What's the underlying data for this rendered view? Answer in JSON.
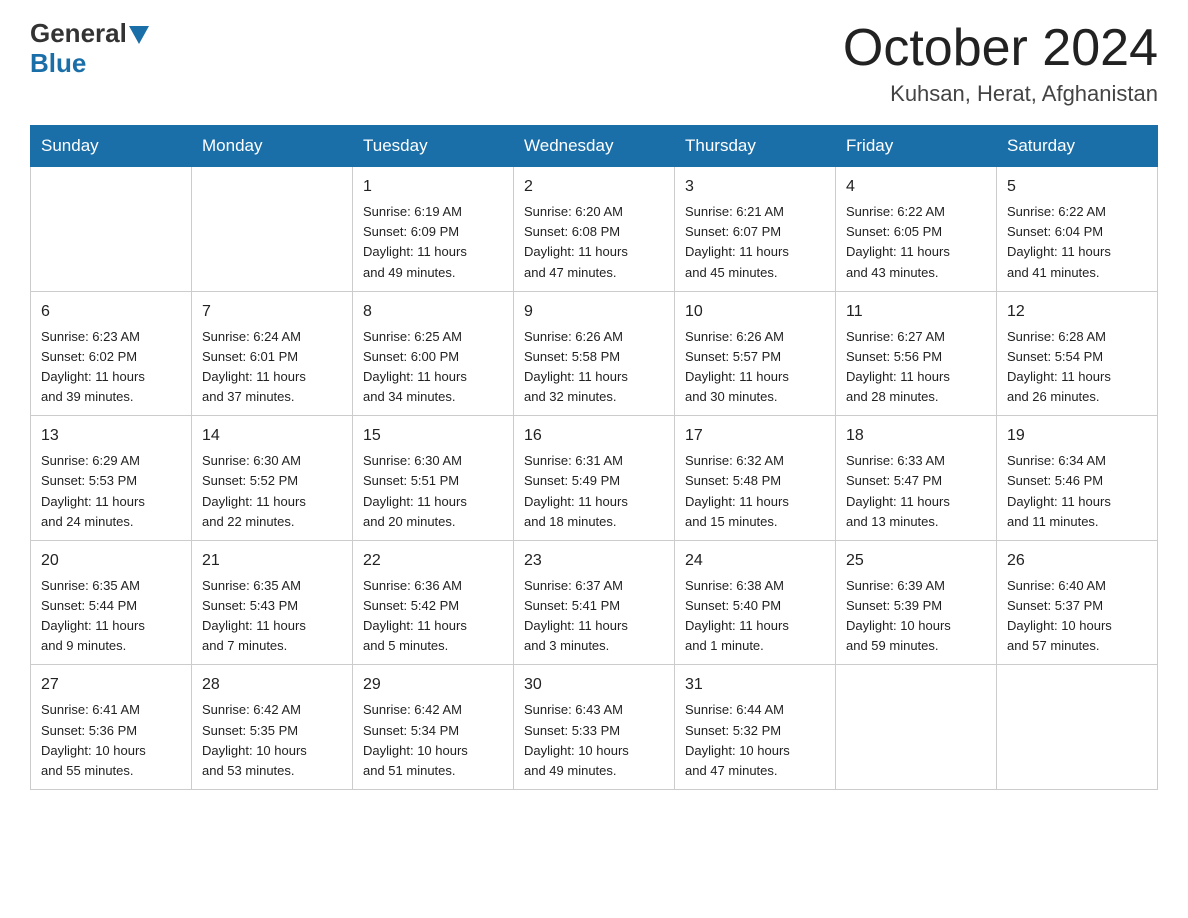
{
  "logo": {
    "general": "General",
    "blue": "Blue"
  },
  "title": "October 2024",
  "location": "Kuhsan, Herat, Afghanistan",
  "days_of_week": [
    "Sunday",
    "Monday",
    "Tuesday",
    "Wednesday",
    "Thursday",
    "Friday",
    "Saturday"
  ],
  "weeks": [
    [
      {
        "day": "",
        "info": ""
      },
      {
        "day": "",
        "info": ""
      },
      {
        "day": "1",
        "info": "Sunrise: 6:19 AM\nSunset: 6:09 PM\nDaylight: 11 hours\nand 49 minutes."
      },
      {
        "day": "2",
        "info": "Sunrise: 6:20 AM\nSunset: 6:08 PM\nDaylight: 11 hours\nand 47 minutes."
      },
      {
        "day": "3",
        "info": "Sunrise: 6:21 AM\nSunset: 6:07 PM\nDaylight: 11 hours\nand 45 minutes."
      },
      {
        "day": "4",
        "info": "Sunrise: 6:22 AM\nSunset: 6:05 PM\nDaylight: 11 hours\nand 43 minutes."
      },
      {
        "day": "5",
        "info": "Sunrise: 6:22 AM\nSunset: 6:04 PM\nDaylight: 11 hours\nand 41 minutes."
      }
    ],
    [
      {
        "day": "6",
        "info": "Sunrise: 6:23 AM\nSunset: 6:02 PM\nDaylight: 11 hours\nand 39 minutes."
      },
      {
        "day": "7",
        "info": "Sunrise: 6:24 AM\nSunset: 6:01 PM\nDaylight: 11 hours\nand 37 minutes."
      },
      {
        "day": "8",
        "info": "Sunrise: 6:25 AM\nSunset: 6:00 PM\nDaylight: 11 hours\nand 34 minutes."
      },
      {
        "day": "9",
        "info": "Sunrise: 6:26 AM\nSunset: 5:58 PM\nDaylight: 11 hours\nand 32 minutes."
      },
      {
        "day": "10",
        "info": "Sunrise: 6:26 AM\nSunset: 5:57 PM\nDaylight: 11 hours\nand 30 minutes."
      },
      {
        "day": "11",
        "info": "Sunrise: 6:27 AM\nSunset: 5:56 PM\nDaylight: 11 hours\nand 28 minutes."
      },
      {
        "day": "12",
        "info": "Sunrise: 6:28 AM\nSunset: 5:54 PM\nDaylight: 11 hours\nand 26 minutes."
      }
    ],
    [
      {
        "day": "13",
        "info": "Sunrise: 6:29 AM\nSunset: 5:53 PM\nDaylight: 11 hours\nand 24 minutes."
      },
      {
        "day": "14",
        "info": "Sunrise: 6:30 AM\nSunset: 5:52 PM\nDaylight: 11 hours\nand 22 minutes."
      },
      {
        "day": "15",
        "info": "Sunrise: 6:30 AM\nSunset: 5:51 PM\nDaylight: 11 hours\nand 20 minutes."
      },
      {
        "day": "16",
        "info": "Sunrise: 6:31 AM\nSunset: 5:49 PM\nDaylight: 11 hours\nand 18 minutes."
      },
      {
        "day": "17",
        "info": "Sunrise: 6:32 AM\nSunset: 5:48 PM\nDaylight: 11 hours\nand 15 minutes."
      },
      {
        "day": "18",
        "info": "Sunrise: 6:33 AM\nSunset: 5:47 PM\nDaylight: 11 hours\nand 13 minutes."
      },
      {
        "day": "19",
        "info": "Sunrise: 6:34 AM\nSunset: 5:46 PM\nDaylight: 11 hours\nand 11 minutes."
      }
    ],
    [
      {
        "day": "20",
        "info": "Sunrise: 6:35 AM\nSunset: 5:44 PM\nDaylight: 11 hours\nand 9 minutes."
      },
      {
        "day": "21",
        "info": "Sunrise: 6:35 AM\nSunset: 5:43 PM\nDaylight: 11 hours\nand 7 minutes."
      },
      {
        "day": "22",
        "info": "Sunrise: 6:36 AM\nSunset: 5:42 PM\nDaylight: 11 hours\nand 5 minutes."
      },
      {
        "day": "23",
        "info": "Sunrise: 6:37 AM\nSunset: 5:41 PM\nDaylight: 11 hours\nand 3 minutes."
      },
      {
        "day": "24",
        "info": "Sunrise: 6:38 AM\nSunset: 5:40 PM\nDaylight: 11 hours\nand 1 minute."
      },
      {
        "day": "25",
        "info": "Sunrise: 6:39 AM\nSunset: 5:39 PM\nDaylight: 10 hours\nand 59 minutes."
      },
      {
        "day": "26",
        "info": "Sunrise: 6:40 AM\nSunset: 5:37 PM\nDaylight: 10 hours\nand 57 minutes."
      }
    ],
    [
      {
        "day": "27",
        "info": "Sunrise: 6:41 AM\nSunset: 5:36 PM\nDaylight: 10 hours\nand 55 minutes."
      },
      {
        "day": "28",
        "info": "Sunrise: 6:42 AM\nSunset: 5:35 PM\nDaylight: 10 hours\nand 53 minutes."
      },
      {
        "day": "29",
        "info": "Sunrise: 6:42 AM\nSunset: 5:34 PM\nDaylight: 10 hours\nand 51 minutes."
      },
      {
        "day": "30",
        "info": "Sunrise: 6:43 AM\nSunset: 5:33 PM\nDaylight: 10 hours\nand 49 minutes."
      },
      {
        "day": "31",
        "info": "Sunrise: 6:44 AM\nSunset: 5:32 PM\nDaylight: 10 hours\nand 47 minutes."
      },
      {
        "day": "",
        "info": ""
      },
      {
        "day": "",
        "info": ""
      }
    ]
  ]
}
